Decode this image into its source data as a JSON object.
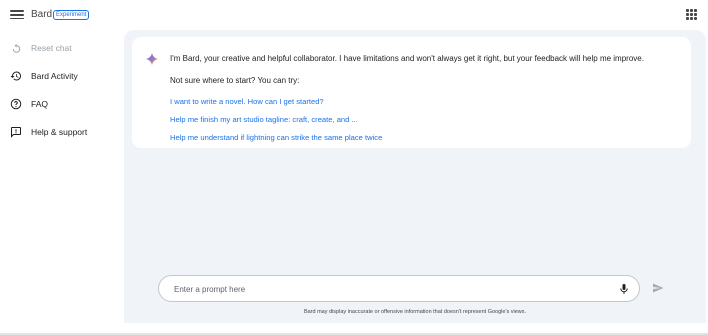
{
  "header": {
    "title": "Bard",
    "badge": "Experiment",
    "menu_icon": "hamburger-menu-icon",
    "apps_icon": "google-apps-grid-icon"
  },
  "sidebar": {
    "items": [
      {
        "label": "Reset chat",
        "icon": "reset-icon",
        "enabled": false
      },
      {
        "label": "Bard Activity",
        "icon": "history-icon",
        "enabled": true
      },
      {
        "label": "FAQ",
        "icon": "help-circle-icon",
        "enabled": true
      },
      {
        "label": "Help & support",
        "icon": "feedback-icon",
        "enabled": true
      }
    ]
  },
  "chat": {
    "intro": "I'm Bard, your creative and helpful collaborator. I have limitations and won't always get it right, but your feedback will help me improve.",
    "try_prompt": "Not sure where to start? You can try:",
    "suggestions": [
      "I want to write a novel. How can I get started?",
      "Help me finish my art studio tagline: craft, create, and ...",
      "Help me understand if lightning can strike the same place twice"
    ]
  },
  "prompt": {
    "placeholder": "Enter a prompt here",
    "value": ""
  },
  "disclaimer": "Bard may display inaccurate or offensive information that doesn't represent Google's views.",
  "colors": {
    "accent": "#1a73e8",
    "main_bg": "#f0f4f9",
    "text": "#1f1f1f"
  }
}
